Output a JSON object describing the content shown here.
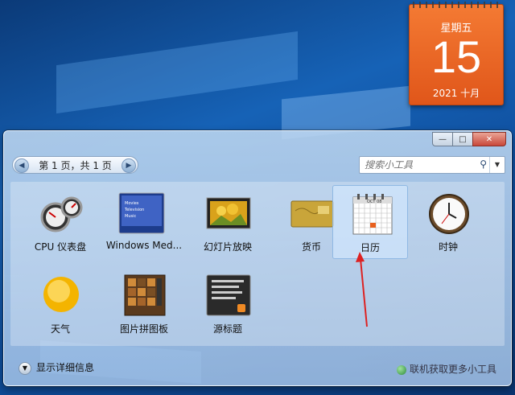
{
  "calendar_gadget": {
    "weekday": "星期五",
    "day": "15",
    "month": "2021 十月"
  },
  "gallery": {
    "controls": {
      "minimize": "—",
      "maximize": "□",
      "close": "✕"
    },
    "pager": {
      "prev": "◀",
      "label": "第 1 页，共 1 页",
      "next": "▶"
    },
    "search": {
      "placeholder": "搜索小工具",
      "icon": "⚲",
      "dropdown": "▼"
    },
    "gadgets": [
      {
        "label": "CPU 仪表盘",
        "icon": "cpu-meter-icon"
      },
      {
        "label": "Windows Med...",
        "icon": "media-center-icon"
      },
      {
        "label": "幻灯片放映",
        "icon": "slideshow-icon"
      },
      {
        "label": "货币",
        "icon": "currency-icon"
      },
      {
        "label": "日历",
        "icon": "calendar-icon",
        "selected": true
      },
      {
        "label": "时钟",
        "icon": "clock-icon"
      },
      {
        "label": "天气",
        "icon": "weather-icon"
      },
      {
        "label": "图片拼图板",
        "icon": "picture-puzzle-icon"
      },
      {
        "label": "源标题",
        "icon": "feed-headlines-icon"
      }
    ],
    "details_label": "显示详细信息",
    "details_chevron": "▼",
    "online_link": "联机获取更多小工具"
  },
  "colors": {
    "calendar_orange": "#e8611f",
    "annotation_arrow": "#d22"
  }
}
